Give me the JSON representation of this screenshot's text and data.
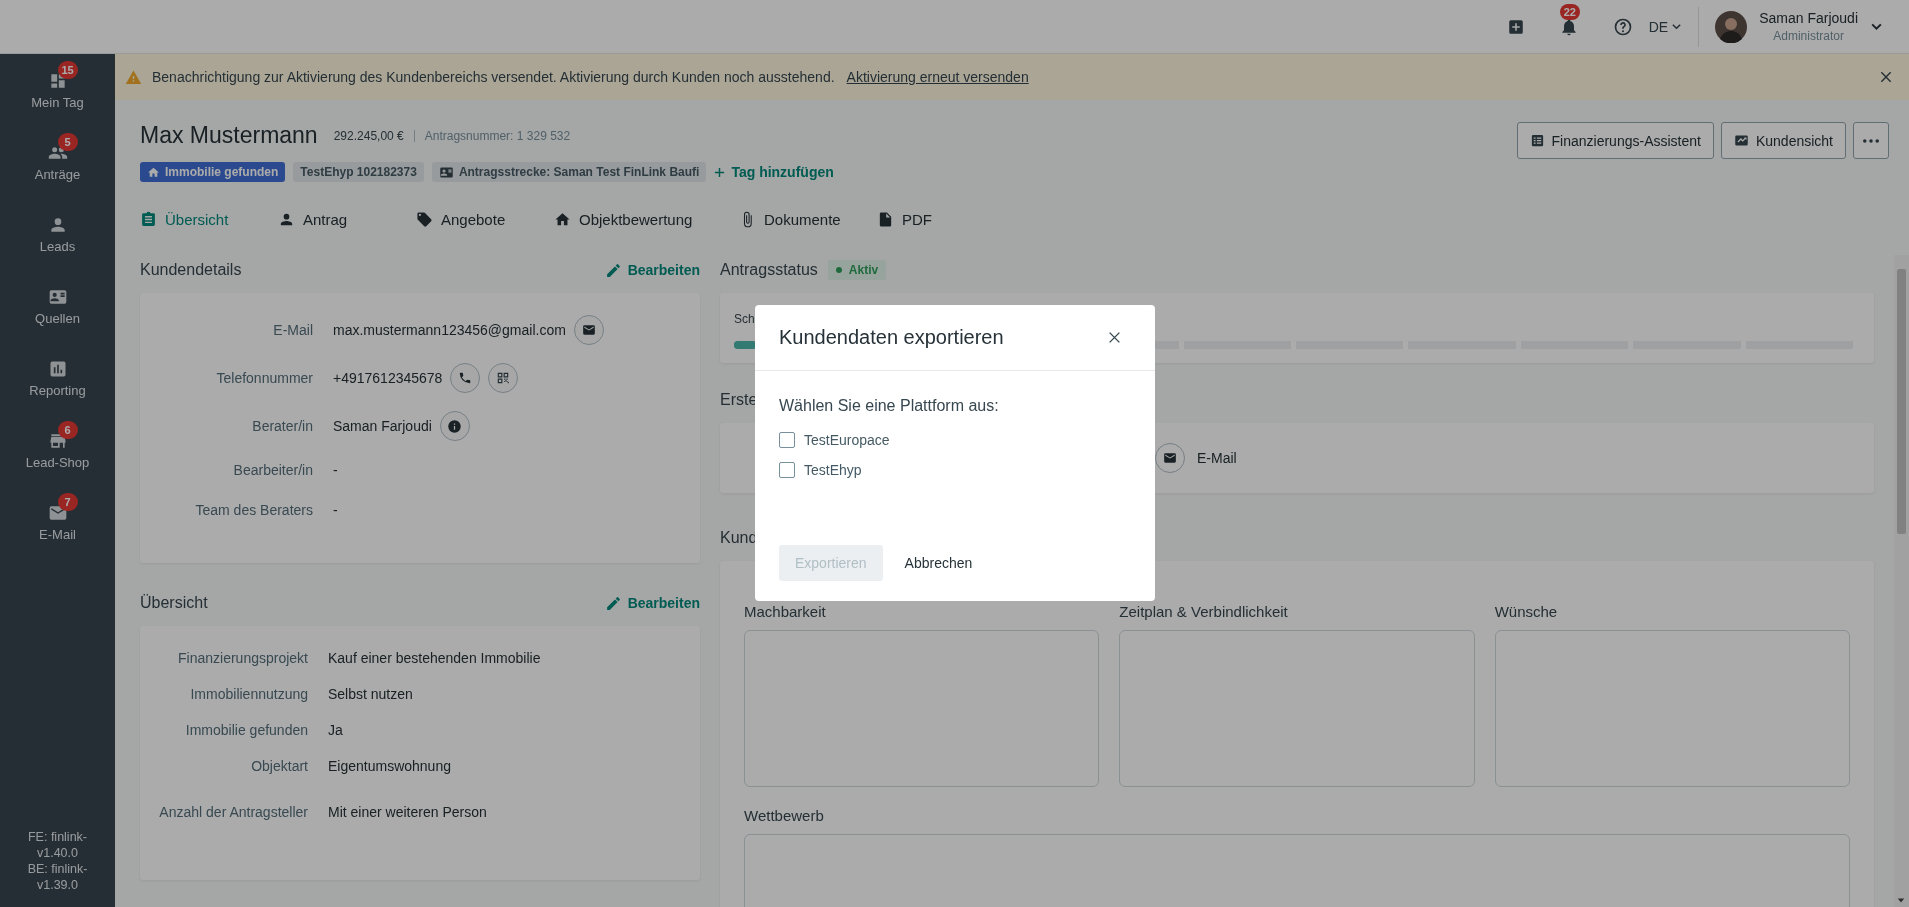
{
  "topbar": {
    "notification_count": "22",
    "language": "DE",
    "user": {
      "name": "Saman Farjoudi",
      "role": "Administrator"
    }
  },
  "sidebar": {
    "items": [
      {
        "label": "Mein Tag",
        "badge": "15"
      },
      {
        "label": "Anträge",
        "badge": "5"
      },
      {
        "label": "Leads"
      },
      {
        "label": "Quellen"
      },
      {
        "label": "Reporting"
      },
      {
        "label": "Lead-Shop",
        "badge": "6"
      },
      {
        "label": "E-Mail",
        "badge": "7"
      }
    ],
    "versions": [
      "FE: finlink-v1.40.0",
      "BE: finlink-v1.39.0"
    ]
  },
  "banner": {
    "message": "Benachrichtigung zur Aktivierung des Kundenbereichs versendet. Aktivierung durch Kunden noch ausstehend.",
    "link": "Aktivierung erneut versenden"
  },
  "header": {
    "name": "Max Mustermann",
    "amount": "292.245,00 €",
    "application_number": "Antragsnummer: 1 329 532",
    "tags": [
      {
        "label": "Immobilie gefunden",
        "kind": "primary"
      },
      {
        "label": "TestEhyp 102182373",
        "kind": "plain"
      },
      {
        "label": "Antragsstrecke: Saman Test FinLink Baufi",
        "kind": "card"
      }
    ],
    "add_tag": "Tag hinzufügen",
    "actions": [
      "Finanzierungs-Assistent",
      "Kundensicht"
    ]
  },
  "tabs": [
    {
      "label": "Übersicht",
      "selected": true
    },
    {
      "label": "Antrag",
      "selected": false
    },
    {
      "label": "Angebote",
      "selected": false
    },
    {
      "label": "Objektbewertung",
      "selected": false
    },
    {
      "label": "Dokumente",
      "selected": false
    },
    {
      "label": "PDF",
      "selected": false
    }
  ],
  "customer_details": {
    "title": "Kundendetails",
    "edit": "Bearbeiten",
    "fields": [
      {
        "label": "E-Mail",
        "value": "max.mustermann123456@gmail.com",
        "kind": "email"
      },
      {
        "label": "Telefonnummer",
        "value": "+4917612345678",
        "kind": "phone"
      },
      {
        "label": "Berater/in",
        "value": "Saman Farjoudi",
        "kind": "person"
      },
      {
        "label": "Bearbeiter/in",
        "value": "-",
        "kind": "text"
      },
      {
        "label": "Team des Beraters",
        "value": "-",
        "kind": "text"
      }
    ]
  },
  "overview": {
    "title": "Übersicht",
    "edit": "Bearbeiten",
    "fields": [
      {
        "label": "Finanzierungsprojekt",
        "value": "Kauf einer bestehenden Immobilie"
      },
      {
        "label": "Immobiliennutzung",
        "value": "Selbst nutzen"
      },
      {
        "label": "Immobilie gefunden",
        "value": "Ja"
      },
      {
        "label": "Objektart",
        "value": "Eigentumswohnung"
      },
      {
        "label": "Anzahl der Antragsteller",
        "value": "Mit einer weiteren Person"
      }
    ]
  },
  "status": {
    "title": "Antragsstatus",
    "badge": "Aktiv",
    "step": "Sch",
    "progress": {
      "level": 0.02
    }
  },
  "contact": {
    "title": "Erste",
    "channel": "E-Mail"
  },
  "customer": {
    "title": "Kund",
    "boxes": [
      "Machbarkeit",
      "Zeitplan & Verbindlichkeit",
      "Wünsche"
    ],
    "wide_box": "Wettbewerb"
  },
  "modal": {
    "title": "Kundendaten exportieren",
    "prompt": "Wählen Sie eine Plattform aus:",
    "options": [
      {
        "label": "TestEuropace",
        "checked": false
      },
      {
        "label": "TestEhyp",
        "checked": false
      }
    ],
    "primary": {
      "label": "Exportieren",
      "disabled": true
    },
    "secondary": "Abbrechen"
  }
}
